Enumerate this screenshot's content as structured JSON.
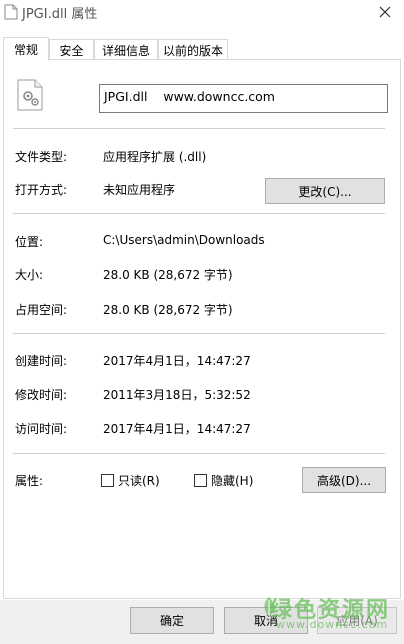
{
  "window": {
    "title": "JPGI.dll 属性"
  },
  "tabs": [
    {
      "label": "常规",
      "active": true
    },
    {
      "label": "安全",
      "active": false
    },
    {
      "label": "详细信息",
      "active": false
    },
    {
      "label": "以前的版本",
      "active": false
    }
  ],
  "file": {
    "name_value": "JPGI.dll    www.downcc.com",
    "icon": "dll-file-icon"
  },
  "info": {
    "type_label": "文件类型:",
    "type_value": "应用程序扩展 (.dll)",
    "open_label": "打开方式:",
    "open_value": "未知应用程序",
    "change_button": "更改(C)...",
    "location_label": "位置:",
    "location_value": "C:\\Users\\admin\\Downloads",
    "size_label": "大小:",
    "size_value": "28.0 KB (28,672 字节)",
    "disk_label": "占用空间:",
    "disk_value": "28.0 KB (28,672 字节)",
    "created_label": "创建时间:",
    "created_value": "2017年4月1日，14:47:27",
    "modified_label": "修改时间:",
    "modified_value": "2011年3月18日，5:32:52",
    "accessed_label": "访问时间:",
    "accessed_value": "2017年4月1日，14:47:27",
    "attr_label": "属性:",
    "readonly_label": "只读(R)",
    "readonly_checked": false,
    "hidden_label": "隐藏(H)",
    "hidden_checked": false,
    "advanced_button": "高级(D)..."
  },
  "buttons": {
    "ok": "确定",
    "cancel": "取消",
    "apply": "应用(A)"
  },
  "watermark": {
    "main": "绿色资源网",
    "sub": "www.downcc.com"
  },
  "colors": {
    "button_face": "#e1e1e1",
    "border": "#d9d9d9",
    "watermark": "#6abe5c"
  }
}
